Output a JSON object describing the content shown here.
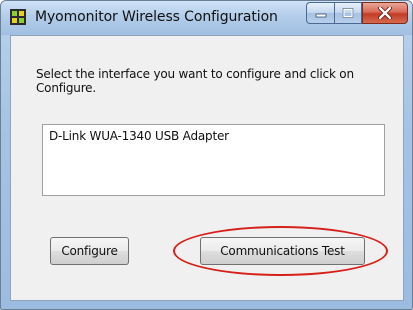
{
  "window": {
    "title": "Myomonitor Wireless Configuration"
  },
  "caption_buttons": {
    "minimize_icon": "minimize-icon",
    "maximize_icon": "maximize-icon",
    "close_icon": "close-icon"
  },
  "dialog": {
    "instruction": "Select the interface you want to configure and click on Configure.",
    "interfaces": [
      "D-Link WUA-1340 USB Adapter"
    ],
    "configure_label": "Configure",
    "comm_test_label": "Communications Test"
  },
  "colors": {
    "highlight": "#d6201a"
  }
}
